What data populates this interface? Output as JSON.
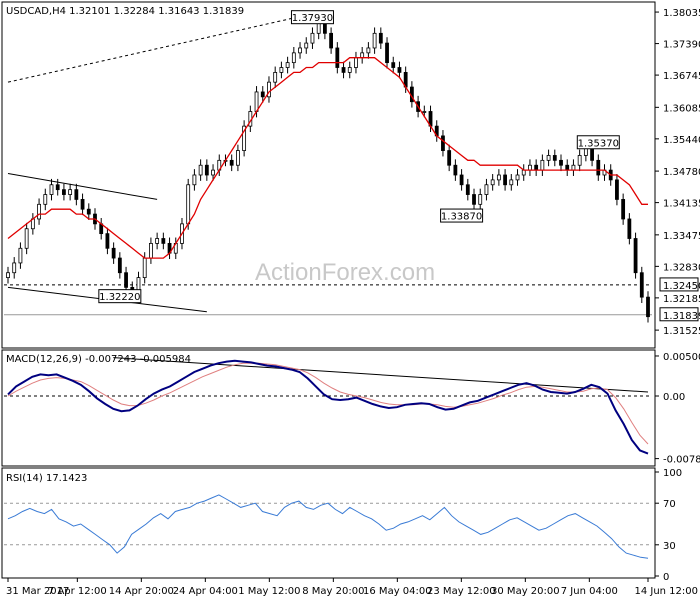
{
  "chart_data": [
    {
      "type": "candlestick",
      "panel": "price",
      "header": "USDCAD,H4  1.32101 1.32284 1.31643 1.31839",
      "ylim": [
        1.312,
        1.382
      ],
      "yticks": [
        "1.38035",
        "1.37390",
        "1.36745",
        "1.36085",
        "1.35440",
        "1.34780",
        "1.34135",
        "1.33475",
        "1.32830",
        "1.32185",
        "1.31525"
      ],
      "ytick_values": [
        1.38035,
        1.3739,
        1.36745,
        1.36085,
        1.3544,
        1.3478,
        1.34135,
        1.33475,
        1.3283,
        1.32185,
        1.31525
      ],
      "close_series": [
        1.327,
        1.329,
        1.332,
        1.336,
        1.338,
        1.341,
        1.343,
        1.345,
        1.344,
        1.343,
        1.344,
        1.342,
        1.34,
        1.339,
        1.337,
        1.335,
        1.332,
        1.33,
        1.327,
        1.324,
        1.323,
        1.326,
        1.33,
        1.333,
        1.334,
        1.333,
        1.331,
        1.333,
        1.337,
        1.345,
        1.347,
        1.349,
        1.347,
        1.348,
        1.35,
        1.35,
        1.349,
        1.352,
        1.357,
        1.36,
        1.364,
        1.363,
        1.366,
        1.368,
        1.369,
        1.37,
        1.372,
        1.373,
        1.374,
        1.376,
        1.378,
        1.376,
        1.373,
        1.369,
        1.368,
        1.369,
        1.371,
        1.372,
        1.373,
        1.376,
        1.374,
        1.37,
        1.369,
        1.368,
        1.365,
        1.362,
        1.36,
        1.36,
        1.357,
        1.355,
        1.352,
        1.349,
        1.347,
        1.345,
        1.343,
        1.341,
        1.343,
        1.345,
        1.346,
        1.347,
        1.345,
        1.346,
        1.347,
        1.348,
        1.349,
        1.348,
        1.35,
        1.351,
        1.35,
        1.349,
        1.348,
        1.349,
        1.351,
        1.353,
        1.35,
        1.347,
        1.348,
        1.346,
        1.342,
        1.338,
        1.334,
        1.327,
        1.322,
        1.318
      ],
      "ma_series": [
        1.334,
        1.335,
        1.336,
        1.337,
        1.338,
        1.339,
        1.339,
        1.34,
        1.34,
        1.34,
        1.34,
        1.339,
        1.339,
        1.338,
        1.338,
        1.337,
        1.336,
        1.335,
        1.334,
        1.333,
        1.332,
        1.331,
        1.33,
        1.33,
        1.33,
        1.33,
        1.331,
        1.333,
        1.335,
        1.337,
        1.339,
        1.342,
        1.344,
        1.346,
        1.348,
        1.35,
        1.352,
        1.354,
        1.356,
        1.358,
        1.36,
        1.362,
        1.364,
        1.365,
        1.366,
        1.367,
        1.368,
        1.368,
        1.369,
        1.369,
        1.37,
        1.37,
        1.37,
        1.37,
        1.37,
        1.371,
        1.371,
        1.371,
        1.371,
        1.371,
        1.37,
        1.369,
        1.368,
        1.367,
        1.365,
        1.363,
        1.361,
        1.359,
        1.357,
        1.355,
        1.354,
        1.353,
        1.352,
        1.351,
        1.35,
        1.35,
        1.349,
        1.349,
        1.349,
        1.349,
        1.349,
        1.349,
        1.349,
        1.348,
        1.348,
        1.348,
        1.348,
        1.348,
        1.348,
        1.348,
        1.348,
        1.348,
        1.348,
        1.348,
        1.348,
        1.348,
        1.348,
        1.347,
        1.347,
        1.346,
        1.345,
        1.343,
        1.341,
        1.341
      ],
      "annotations": [
        {
          "label": "1.37930",
          "value": 1.3793,
          "bar": 49
        },
        {
          "label": "1.35370",
          "value": 1.3537,
          "bar": 95
        },
        {
          "label": "1.33870",
          "value": 1.3387,
          "bar": 73
        },
        {
          "label": "1.32220",
          "value": 1.3222,
          "bar": 18
        }
      ],
      "hlines": [
        {
          "label": "1.32450",
          "value": 1.3245,
          "style": "dashed"
        },
        {
          "label": "1.31839",
          "value": 1.31839,
          "style": "solid-gray"
        }
      ],
      "trendlines": [
        {
          "from_bar": 0,
          "from_value": 1.366,
          "to_bar": 49,
          "to_value": 1.38,
          "style": "dotted"
        },
        {
          "from_bar": 0,
          "from_value": 1.3473,
          "to_bar": 24,
          "to_value": 1.342,
          "style": "solid"
        },
        {
          "from_bar": 0,
          "from_value": 1.324,
          "to_bar": 32,
          "to_value": 1.319,
          "style": "solid"
        }
      ],
      "watermark": "ActionForex.com"
    },
    {
      "type": "line",
      "panel": "macd",
      "header": "MACD(12,26,9) -0.007243 -0.005984",
      "ylim": [
        -0.0085,
        0.0055
      ],
      "yticks": [
        "0.005003",
        "0.00",
        "-0.007826"
      ],
      "ytick_values": [
        0.005003,
        0.0,
        -0.007826
      ],
      "zero_line": "dashed",
      "macd_series": [
        0.0002,
        0.0012,
        0.0018,
        0.0024,
        0.0027,
        0.0026,
        0.0027,
        0.0023,
        0.0019,
        0.0014,
        0.0006,
        -0.0003,
        -0.001,
        -0.0016,
        -0.0019,
        -0.0018,
        -0.0012,
        -0.0004,
        0.0003,
        0.0008,
        0.0012,
        0.0018,
        0.0024,
        0.003,
        0.0034,
        0.0038,
        0.0041,
        0.0043,
        0.0044,
        0.0043,
        0.0042,
        0.004,
        0.0038,
        0.0037,
        0.0035,
        0.0033,
        0.003,
        0.0022,
        0.0012,
        0.0002,
        -0.0004,
        -0.0005,
        -0.0004,
        -0.0002,
        -0.0006,
        -0.001,
        -0.0013,
        -0.0015,
        -0.0014,
        -0.0011,
        -0.001,
        -0.0009,
        -0.001,
        -0.0014,
        -0.0017,
        -0.0016,
        -0.0012,
        -0.0008,
        -0.0006,
        -0.0002,
        0.0002,
        0.0006,
        0.001,
        0.0014,
        0.0016,
        0.0013,
        0.0008,
        0.0005,
        0.0004,
        0.0003,
        0.0005,
        0.0009,
        0.0014,
        0.0011,
        0.0003,
        -0.0018,
        -0.0035,
        -0.0055,
        -0.0068,
        -0.0072
      ],
      "signal_series": [
        0.0,
        0.0006,
        0.0011,
        0.0016,
        0.002,
        0.0022,
        0.0023,
        0.0022,
        0.002,
        0.0018,
        0.0013,
        0.0007,
        0.0001,
        -0.0005,
        -0.001,
        -0.0012,
        -0.0012,
        -0.0009,
        -0.0005,
        0.0,
        0.0004,
        0.0009,
        0.0014,
        0.0019,
        0.0024,
        0.0028,
        0.0032,
        0.0036,
        0.0039,
        0.0041,
        0.0041,
        0.0041,
        0.004,
        0.0039,
        0.0037,
        0.0035,
        0.0033,
        0.0029,
        0.0023,
        0.0016,
        0.001,
        0.0005,
        0.0002,
        0.0,
        -0.0002,
        -0.0005,
        -0.0008,
        -0.001,
        -0.0011,
        -0.0011,
        -0.0011,
        -0.001,
        -0.001,
        -0.0011,
        -0.0013,
        -0.0014,
        -0.0013,
        -0.0011,
        -0.0009,
        -0.0006,
        -0.0003,
        0.0001,
        0.0004,
        0.0008,
        0.0011,
        0.0012,
        0.0011,
        0.0009,
        0.0007,
        0.0005,
        0.0005,
        0.0006,
        0.0009,
        0.001,
        0.0008,
        -0.0002,
        -0.0016,
        -0.0033,
        -0.0049,
        -0.006
      ],
      "trendline": {
        "from_bar": 13,
        "from_value": 0.0048,
        "to_bar": 79,
        "to_value": 0.0005
      }
    },
    {
      "type": "line",
      "panel": "rsi",
      "header": "RSI(14) 17.1423",
      "ylim": [
        0,
        100
      ],
      "yticks": [
        "100",
        "70",
        "30",
        "0"
      ],
      "ytick_values": [
        100,
        70,
        30,
        0
      ],
      "levels": [
        70,
        30
      ],
      "series": [
        55,
        58,
        62,
        65,
        62,
        60,
        64,
        55,
        52,
        48,
        50,
        45,
        40,
        35,
        30,
        22,
        28,
        40,
        45,
        50,
        56,
        60,
        55,
        62,
        64,
        66,
        70,
        72,
        75,
        78,
        74,
        70,
        66,
        68,
        70,
        62,
        60,
        58,
        66,
        70,
        72,
        66,
        64,
        68,
        70,
        64,
        60,
        66,
        62,
        58,
        55,
        50,
        44,
        46,
        50,
        52,
        55,
        58,
        54,
        60,
        66,
        58,
        52,
        48,
        44,
        40,
        42,
        46,
        50,
        54,
        56,
        52,
        48,
        44,
        46,
        50,
        54,
        58,
        60,
        56,
        52,
        48,
        42,
        36,
        28,
        22,
        20,
        18,
        17
      ]
    }
  ],
  "xaxis": {
    "labels": [
      "31 Mar 2017",
      "7 Apr 12:00",
      "14 Apr 20:00",
      "24 Apr 04:00",
      "1 May 12:00",
      "8 May 20:00",
      "16 May 04:00",
      "23 May 12:00",
      "30 May 20:00",
      "7 Jun 04:00",
      "14 Jun 12:00"
    ],
    "label_bars": [
      0,
      13,
      25,
      37,
      49,
      61,
      73,
      85,
      97,
      109,
      120
    ]
  }
}
